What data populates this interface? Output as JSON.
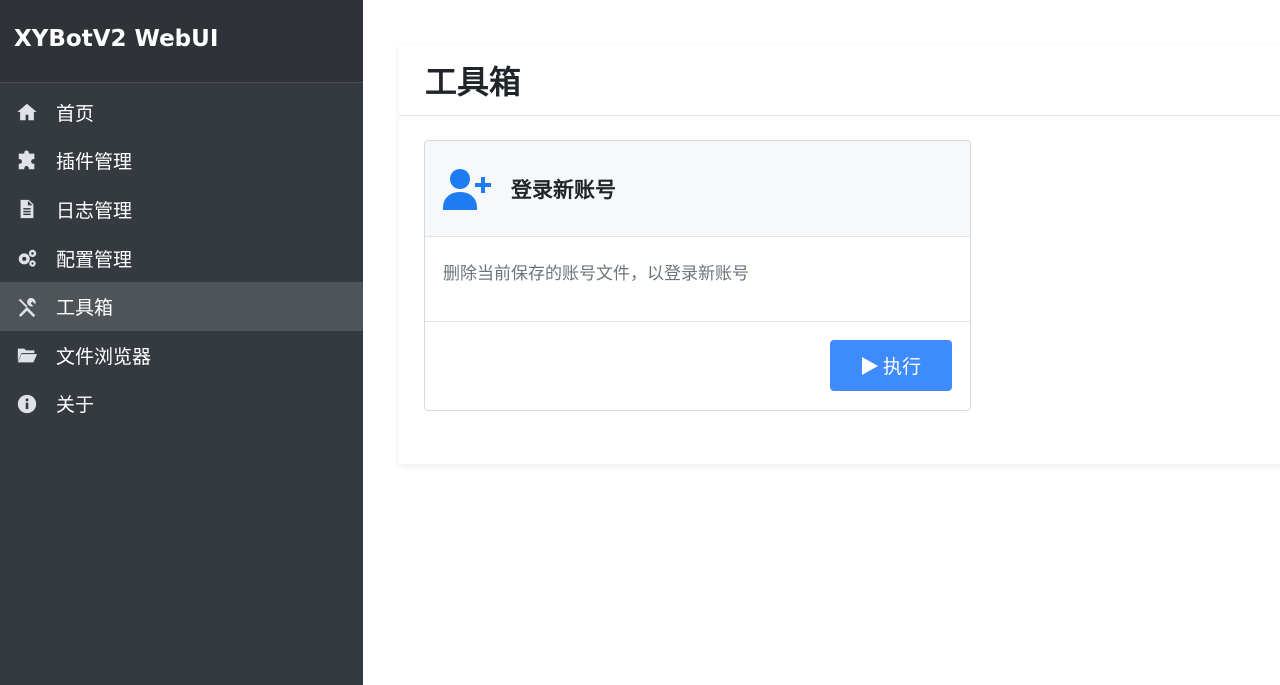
{
  "sidebar": {
    "brand": "XYBotV2 WebUI",
    "items": [
      {
        "label": "首页",
        "icon": "home-icon",
        "active": false
      },
      {
        "label": "插件管理",
        "icon": "puzzle-icon",
        "active": false
      },
      {
        "label": "日志管理",
        "icon": "file-text-icon",
        "active": false
      },
      {
        "label": "配置管理",
        "icon": "gears-icon",
        "active": false
      },
      {
        "label": "工具箱",
        "icon": "tools-icon",
        "active": true
      },
      {
        "label": "文件浏览器",
        "icon": "folder-open-icon",
        "active": false
      },
      {
        "label": "关于",
        "icon": "info-icon",
        "active": false
      }
    ]
  },
  "main": {
    "title": "工具箱",
    "card": {
      "icon": "user-plus-icon",
      "title": "登录新账号",
      "description": "删除当前保存的账号文件，以登录新账号",
      "button_label": "执行",
      "button_icon": "play-icon"
    }
  },
  "colors": {
    "sidebar_bg": "#343a40",
    "sidebar_active": "#4f5459",
    "accent": "#3d8bfd",
    "icon_blue": "#1e7cf2"
  }
}
